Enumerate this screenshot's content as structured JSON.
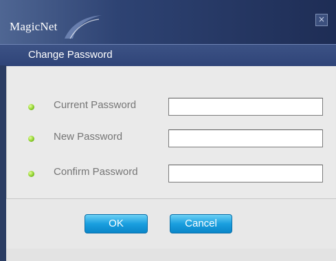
{
  "window": {
    "app_name": "MagicNet",
    "close_glyph": "×",
    "title": "Change Password"
  },
  "form": {
    "fields": [
      {
        "label": "Current Password",
        "value": ""
      },
      {
        "label": "New Password",
        "value": ""
      },
      {
        "label": "Confirm Password",
        "value": ""
      }
    ]
  },
  "buttons": {
    "ok": "OK",
    "cancel": "Cancel"
  },
  "colors": {
    "title_bar": "#2e4373",
    "status_dot": "#8fd12f",
    "button": "#1a9fdf"
  },
  "icons": {
    "close": "close-icon",
    "status": "status-dot-icon"
  }
}
